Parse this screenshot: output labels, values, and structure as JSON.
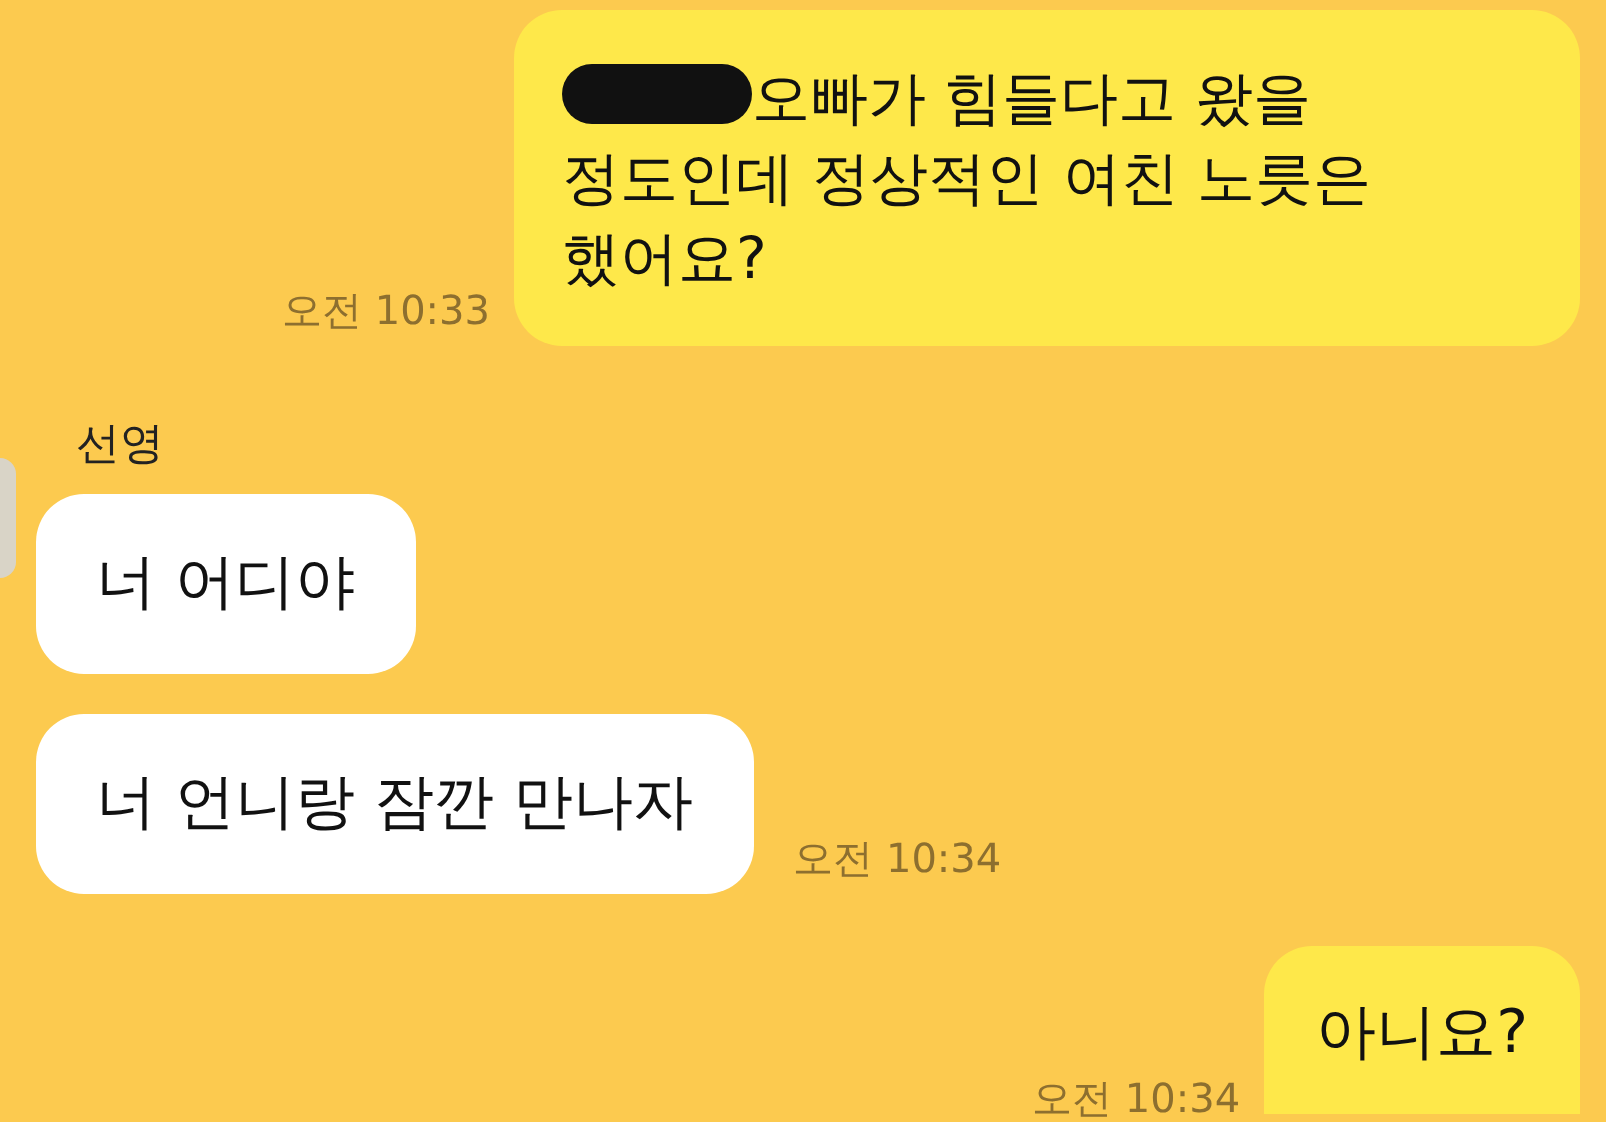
{
  "messages": [
    {
      "kind": "sent",
      "redacted_prefix": true,
      "text": "오빠가 힘들다고 왔을 정도인데 정상적인 여친 노릇은 했어요?",
      "time": "오전 10:33"
    },
    {
      "kind": "received_group",
      "sender": "선영",
      "bubbles": [
        {
          "text": "너 어디야"
        },
        {
          "text": "너 언니랑 잠깐 만나자",
          "time": "오전 10:34"
        }
      ]
    },
    {
      "kind": "sent",
      "redacted_prefix": false,
      "text": "아니요?",
      "time": "오전 10:34"
    }
  ]
}
